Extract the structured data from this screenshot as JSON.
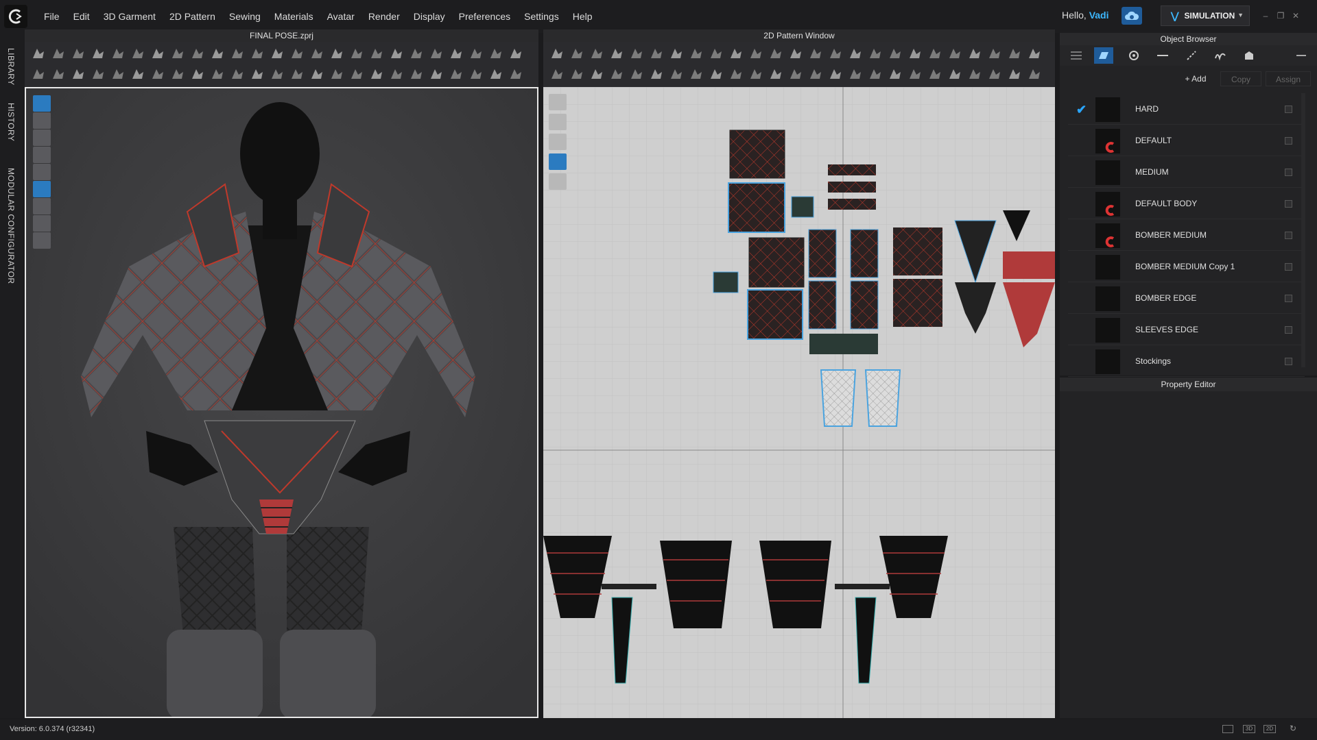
{
  "menu": [
    "File",
    "Edit",
    "3D Garment",
    "2D Pattern",
    "Sewing",
    "Materials",
    "Avatar",
    "Render",
    "Display",
    "Preferences",
    "Settings",
    "Help"
  ],
  "user": {
    "greeting": "Hello, ",
    "name": "Vadi"
  },
  "mode": {
    "label": "SIMULATION"
  },
  "side_tabs": [
    "LIBRARY",
    "HISTORY",
    "MODULAR CONFIGURATOR"
  ],
  "panels": {
    "viewport3d_title": "FINAL POSE.zprj",
    "pattern_title": "2D Pattern Window",
    "object_browser_title": "Object Browser",
    "property_editor_title": "Property Editor"
  },
  "object_browser": {
    "buttons": {
      "add": "Add",
      "copy": "Copy",
      "assign": "Assign"
    },
    "materials": [
      {
        "name": "HARD",
        "selected": true,
        "logo": false
      },
      {
        "name": "DEFAULT",
        "selected": false,
        "logo": true
      },
      {
        "name": "MEDIUM",
        "selected": false,
        "logo": false
      },
      {
        "name": "DEFAULT BODY",
        "selected": false,
        "logo": true
      },
      {
        "name": "BOMBER MEDIUM",
        "selected": false,
        "logo": true
      },
      {
        "name": "BOMBER MEDIUM Copy 1",
        "selected": false,
        "logo": false
      },
      {
        "name": "BOMBER EDGE",
        "selected": false,
        "logo": false
      },
      {
        "name": "SLEEVES EDGE",
        "selected": false,
        "logo": false
      },
      {
        "name": "Stockings",
        "selected": false,
        "logo": false
      }
    ]
  },
  "status": {
    "version": "Version: 6.0.374 (r32341)"
  },
  "colors": {
    "accent": "#2aa6ff",
    "trim": "#c0392b",
    "panel": "#232325"
  }
}
